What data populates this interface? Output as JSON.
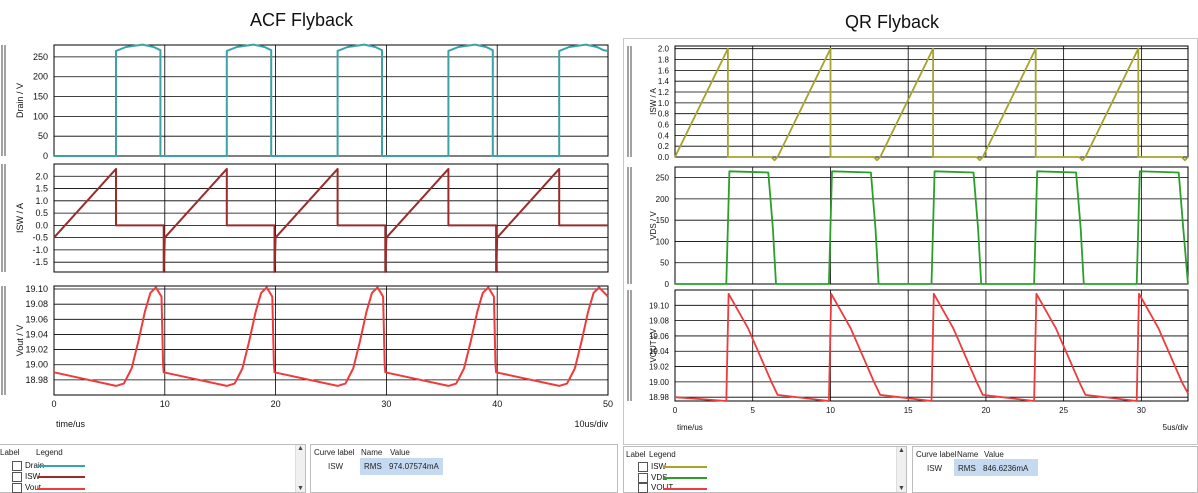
{
  "left_title": "ACF Flyback",
  "right_title": "QR Flyback",
  "chart_data": [
    {
      "type": "line",
      "figure": "ACF Flyback",
      "xlabel": "time/us",
      "x_range": [
        0,
        50
      ],
      "x_ticks": [
        "0",
        "10",
        "20",
        "30",
        "40",
        "50"
      ],
      "div_label": "10us/div",
      "series": [
        {
          "name": "Drain",
          "ylabel": "Drain / V",
          "color": "#3aa3a8",
          "ylim": [
            0,
            280
          ],
          "y_ticks": [
            "250",
            "200",
            "150",
            "100",
            "50",
            "0"
          ],
          "points": [
            [
              0,
              0
            ],
            [
              5.6,
              0
            ],
            [
              5.6,
              265
            ],
            [
              6.5,
              275
            ],
            [
              8,
              281
            ],
            [
              9,
              275
            ],
            [
              9.6,
              267
            ],
            [
              9.6,
              0
            ],
            [
              15.6,
              0
            ],
            [
              15.6,
              265
            ],
            [
              16.5,
              275
            ],
            [
              18,
              281
            ],
            [
              19,
              275
            ],
            [
              19.6,
              267
            ],
            [
              19.6,
              0
            ],
            [
              25.6,
              0
            ],
            [
              25.6,
              265
            ],
            [
              26.5,
              275
            ],
            [
              28,
              281
            ],
            [
              29,
              275
            ],
            [
              29.6,
              267
            ],
            [
              29.6,
              0
            ],
            [
              35.6,
              0
            ],
            [
              35.6,
              265
            ],
            [
              36.5,
              275
            ],
            [
              38,
              281
            ],
            [
              39,
              275
            ],
            [
              39.6,
              267
            ],
            [
              39.6,
              0
            ],
            [
              45.6,
              0
            ],
            [
              45.6,
              265
            ],
            [
              46.5,
              275
            ],
            [
              48,
              281
            ],
            [
              49,
              275
            ],
            [
              49.6,
              267
            ],
            [
              50,
              265
            ]
          ]
        },
        {
          "name": "ISW",
          "ylabel": "ISW / A",
          "color": "#9b2c2c",
          "ylim": [
            -1.9,
            2.5
          ],
          "y_ticks": [
            "2.0",
            "1.5",
            "1.0",
            "0.5",
            "0.0",
            "-0.5",
            "-1.0",
            "-1.5"
          ],
          "points": [
            [
              0,
              -0.5
            ],
            [
              5.6,
              2.3
            ],
            [
              5.6,
              0
            ],
            [
              9.9,
              0
            ],
            [
              9.9,
              -1.9
            ],
            [
              10,
              -0.5
            ],
            [
              15.6,
              2.3
            ],
            [
              15.6,
              0
            ],
            [
              19.9,
              0
            ],
            [
              19.9,
              -1.9
            ],
            [
              20,
              -0.5
            ],
            [
              25.6,
              2.3
            ],
            [
              25.6,
              0
            ],
            [
              29.9,
              0
            ],
            [
              29.9,
              -1.9
            ],
            [
              30,
              -0.5
            ],
            [
              35.6,
              2.3
            ],
            [
              35.6,
              0
            ],
            [
              39.9,
              0
            ],
            [
              39.9,
              -1.9
            ],
            [
              40,
              -0.5
            ],
            [
              45.6,
              2.3
            ],
            [
              45.6,
              0
            ],
            [
              50,
              0
            ]
          ]
        },
        {
          "name": "Vout",
          "ylabel": "Vout / V",
          "color": "#ef3b3b",
          "ylim": [
            18.96,
            19.104
          ],
          "y_ticks": [
            "19.10",
            "19.08",
            "19.06",
            "19.04",
            "19.02",
            "19.00",
            "18.98"
          ],
          "points": [
            [
              0,
              18.99
            ],
            [
              5.6,
              18.972
            ],
            [
              6.3,
              18.975
            ],
            [
              7.0,
              18.995
            ],
            [
              7.6,
              19.03
            ],
            [
              8.2,
              19.07
            ],
            [
              8.7,
              19.095
            ],
            [
              9.2,
              19.102
            ],
            [
              9.7,
              19.09
            ],
            [
              9.85,
              19.0
            ],
            [
              9.9,
              18.99
            ],
            [
              15.6,
              18.972
            ],
            [
              16.3,
              18.975
            ],
            [
              17.0,
              18.995
            ],
            [
              17.6,
              19.03
            ],
            [
              18.2,
              19.07
            ],
            [
              18.7,
              19.095
            ],
            [
              19.2,
              19.102
            ],
            [
              19.7,
              19.09
            ],
            [
              19.85,
              19.0
            ],
            [
              19.9,
              18.99
            ],
            [
              25.6,
              18.972
            ],
            [
              26.3,
              18.975
            ],
            [
              27.0,
              18.995
            ],
            [
              27.6,
              19.03
            ],
            [
              28.2,
              19.07
            ],
            [
              28.7,
              19.095
            ],
            [
              29.2,
              19.102
            ],
            [
              29.7,
              19.09
            ],
            [
              29.85,
              19.0
            ],
            [
              29.9,
              18.99
            ],
            [
              35.6,
              18.972
            ],
            [
              36.3,
              18.975
            ],
            [
              37.0,
              18.995
            ],
            [
              37.6,
              19.03
            ],
            [
              38.2,
              19.07
            ],
            [
              38.7,
              19.095
            ],
            [
              39.2,
              19.102
            ],
            [
              39.7,
              19.09
            ],
            [
              39.85,
              19.0
            ],
            [
              39.9,
              18.99
            ],
            [
              45.6,
              18.972
            ],
            [
              46.3,
              18.975
            ],
            [
              47.0,
              18.995
            ],
            [
              47.6,
              19.03
            ],
            [
              48.2,
              19.07
            ],
            [
              48.7,
              19.095
            ],
            [
              49.2,
              19.102
            ],
            [
              50,
              19.09
            ]
          ]
        }
      ],
      "legend": {
        "header_label": "Label",
        "header_legend": "Legend",
        "items": [
          "Drain",
          "ISW",
          "Vout"
        ]
      },
      "measurement": {
        "header_curve": "Curve label",
        "header_name": "Name",
        "header_value": "Value",
        "curve": "ISW",
        "name": "RMS",
        "value": "974.07574mA"
      }
    },
    {
      "type": "line",
      "figure": "QR Flyback",
      "xlabel": "time/us",
      "x_range": [
        0,
        33
      ],
      "x_ticks": [
        "0",
        "5",
        "10",
        "15",
        "20",
        "25",
        "30"
      ],
      "div_label": "5us/div",
      "series": [
        {
          "name": "ISW",
          "ylabel": "ISW / A",
          "color": "#a6a32e",
          "ylim": [
            0,
            2.05
          ],
          "y_ticks": [
            "2.0",
            "1.8",
            "1.6",
            "1.4",
            "1.2",
            "1.0",
            "0.8",
            "0.6",
            "0.4",
            "0.2",
            "0.0"
          ],
          "points": [
            [
              0,
              0
            ],
            [
              3.4,
              2.0
            ],
            [
              3.4,
              0
            ],
            [
              6.2,
              0
            ],
            [
              6.4,
              -0.06
            ],
            [
              6.6,
              0
            ],
            [
              10.0,
              2.0
            ],
            [
              10.0,
              0
            ],
            [
              12.8,
              0
            ],
            [
              13.0,
              -0.06
            ],
            [
              13.2,
              0
            ],
            [
              16.6,
              2.0
            ],
            [
              16.6,
              0
            ],
            [
              19.4,
              0
            ],
            [
              19.6,
              -0.06
            ],
            [
              19.8,
              0
            ],
            [
              23.2,
              2.0
            ],
            [
              23.2,
              0
            ],
            [
              26.0,
              0
            ],
            [
              26.2,
              -0.06
            ],
            [
              26.4,
              0
            ],
            [
              29.8,
              2.0
            ],
            [
              29.8,
              0
            ],
            [
              32.6,
              0
            ],
            [
              32.8,
              -0.06
            ],
            [
              33,
              0
            ]
          ]
        },
        {
          "name": "VDS",
          "ylabel": "VDS / V",
          "color": "#2aa02a",
          "ylim": [
            0,
            275
          ],
          "y_ticks": [
            "250",
            "200",
            "150",
            "100",
            "50",
            "0"
          ],
          "points": [
            [
              0,
              0
            ],
            [
              3.3,
              0
            ],
            [
              3.5,
              265
            ],
            [
              6.0,
              262
            ],
            [
              6.3,
              130
            ],
            [
              6.5,
              0
            ],
            [
              9.9,
              0
            ],
            [
              10.1,
              265
            ],
            [
              12.6,
              262
            ],
            [
              12.9,
              130
            ],
            [
              13.1,
              0
            ],
            [
              16.5,
              0
            ],
            [
              16.7,
              265
            ],
            [
              19.2,
              262
            ],
            [
              19.5,
              130
            ],
            [
              19.7,
              0
            ],
            [
              23.1,
              0
            ],
            [
              23.3,
              265
            ],
            [
              25.8,
              262
            ],
            [
              26.1,
              130
            ],
            [
              26.3,
              0
            ],
            [
              29.7,
              0
            ],
            [
              29.9,
              265
            ],
            [
              32.4,
              262
            ],
            [
              32.7,
              130
            ],
            [
              33,
              0
            ]
          ]
        },
        {
          "name": "VOUT",
          "ylabel": "VOUT / V",
          "color": "#ef3b3b",
          "ylim": [
            18.975,
            19.12
          ],
          "y_ticks": [
            "19.10",
            "19.08",
            "19.06",
            "19.04",
            "19.02",
            "19.00",
            "18.98"
          ],
          "points": [
            [
              0,
              18.98
            ],
            [
              3.3,
              18.975
            ],
            [
              3.45,
              19.115
            ],
            [
              4.7,
              19.07
            ],
            [
              6.2,
              19.0
            ],
            [
              6.6,
              18.983
            ],
            [
              9.9,
              18.975
            ],
            [
              10.05,
              19.115
            ],
            [
              11.3,
              19.07
            ],
            [
              12.8,
              19.0
            ],
            [
              13.2,
              18.983
            ],
            [
              16.5,
              18.975
            ],
            [
              16.65,
              19.115
            ],
            [
              17.9,
              19.07
            ],
            [
              19.4,
              19.0
            ],
            [
              19.8,
              18.983
            ],
            [
              23.1,
              18.975
            ],
            [
              23.25,
              19.115
            ],
            [
              24.5,
              19.07
            ],
            [
              26.0,
              19.0
            ],
            [
              26.4,
              18.983
            ],
            [
              29.7,
              18.975
            ],
            [
              29.85,
              19.115
            ],
            [
              31.1,
              19.07
            ],
            [
              32.6,
              19.0
            ],
            [
              33,
              18.985
            ]
          ]
        }
      ],
      "legend": {
        "header_label": "Label",
        "header_legend": "Legend",
        "items": [
          "ISW",
          "VDS",
          "VOUT"
        ]
      },
      "measurement": {
        "header_curve": "Curve label",
        "header_name": "Name",
        "header_value": "Value",
        "curve": "ISW",
        "name": "RMS",
        "value": "846.6236mA"
      }
    }
  ]
}
